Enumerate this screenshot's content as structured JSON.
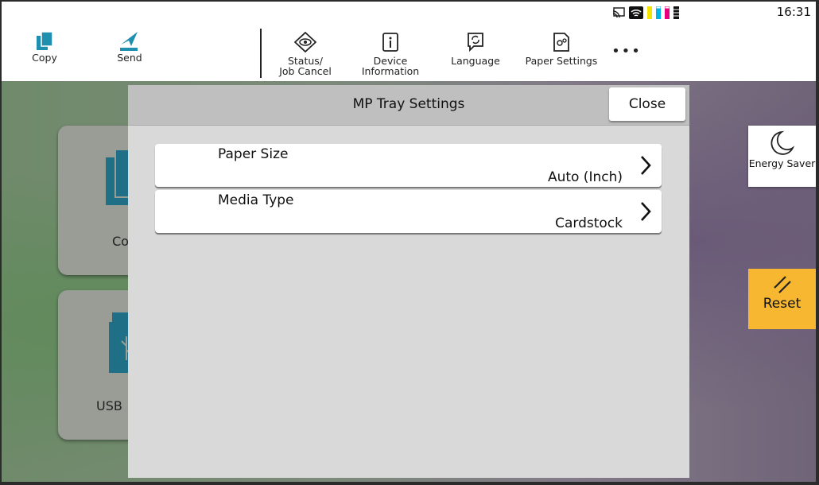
{
  "status_bar": {
    "time": "16:31"
  },
  "toolbar": {
    "copy_label": "Copy",
    "send_label": "Send",
    "status_label_1": "Status/",
    "status_label_2": "Job Cancel",
    "device_label_1": "Device",
    "device_label_2": "Information",
    "language_label": "Language",
    "paper_settings_label": "Paper Settings",
    "more_label": "•••"
  },
  "home_cards": [
    {
      "label": "Co"
    },
    {
      "label": "USB"
    }
  ],
  "dialog": {
    "title": "MP Tray Settings",
    "close_label": "Close",
    "rows": [
      {
        "name": "Paper Size",
        "value": "Auto (Inch)"
      },
      {
        "name": "Media Type",
        "value": "Cardstock"
      }
    ]
  },
  "side": {
    "energy_saver_label": "Energy Saver",
    "reset_label": "Reset"
  },
  "colors": {
    "accent": "#1f8fb0",
    "reset": "#f7b731"
  }
}
